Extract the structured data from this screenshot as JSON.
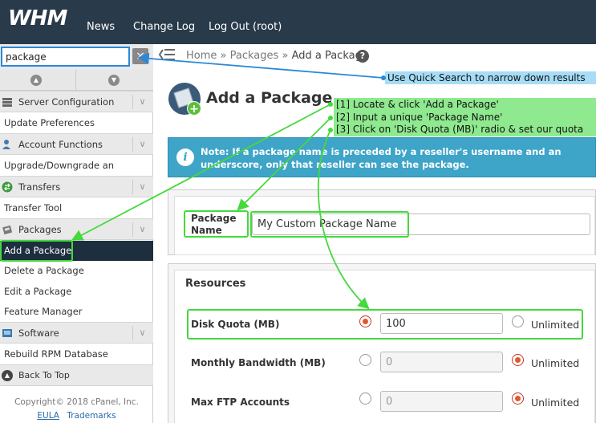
{
  "header": {
    "logo": "WHM",
    "nav": [
      "News",
      "Change Log",
      "Log Out (root)"
    ]
  },
  "search": {
    "value": "package",
    "clear_icon": "close-icon"
  },
  "breadcrumb": {
    "home": "Home",
    "sep": "»",
    "packages": "Packages",
    "current": "Add a Package"
  },
  "sidebar": {
    "sections": [
      {
        "label": "Server Configuration",
        "icon": "server-config-icon",
        "items": [
          "Update Preferences"
        ]
      },
      {
        "label": "Account Functions",
        "icon": "user-icon",
        "items": [
          "Upgrade/Downgrade an Account"
        ]
      },
      {
        "label": "Transfers",
        "icon": "transfer-icon",
        "items": [
          "Transfer Tool"
        ]
      },
      {
        "label": "Packages",
        "icon": "package-icon",
        "items": [
          "Add a Package",
          "Delete a Package",
          "Edit a Package",
          "Feature Manager"
        ]
      },
      {
        "label": "Software",
        "icon": "software-icon",
        "items": [
          "Rebuild RPM Database"
        ]
      }
    ],
    "back_to_top": "Back To Top",
    "copyright": "Copyright© 2018 cPanel, Inc.",
    "eula": "EULA",
    "trademarks": "Trademarks"
  },
  "main": {
    "title": "Add a Package",
    "note_prefix": "Note:",
    "note_text": " If a package name is preceded by a reseller's username and an underscore, only that reseller can see the package.",
    "package_name_label_1": "Package",
    "package_name_label_2": "Name",
    "package_name_value": "My Custom Package Name",
    "resources_heading": "Resources",
    "resources": [
      {
        "label": "Disk Quota (MB)",
        "value": "100",
        "unlimited_label": "Unlimited",
        "mode": "custom"
      },
      {
        "label": "Monthly Bandwidth (MB)",
        "value": "0",
        "unlimited_label": "Unlimited",
        "mode": "unlimited"
      },
      {
        "label": "Max FTP Accounts",
        "value": "0",
        "unlimited_label": "Unlimited",
        "mode": "unlimited"
      }
    ]
  },
  "annotations": {
    "search_tip": "Use Quick Search to narrow down results",
    "steps": [
      "[1] Locate & click 'Add a Package'",
      "[2] Input a unique 'Package Name'",
      "[3] Click on 'Disk Quota (MB)' radio & set our quota"
    ],
    "highlight_color": "#44d93c",
    "tip_color": "#2a88d8"
  }
}
